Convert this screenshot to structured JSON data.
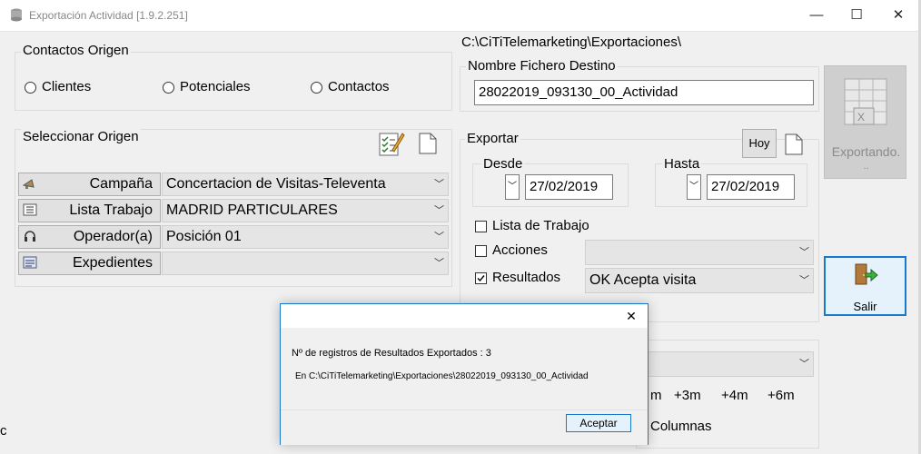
{
  "window": {
    "title": "Exportación Actividad [1.9.2.251]",
    "min_glyph": "—",
    "max_glyph": "☐",
    "close_glyph": "✕"
  },
  "contactos_origen": {
    "label": "Contactos Origen",
    "options": [
      "Clientes",
      "Potenciales",
      "Contactos"
    ]
  },
  "seleccionar_origen": {
    "label": "Seleccionar Origen",
    "rows": [
      {
        "button": "Campaña",
        "value": "Concertacion de Visitas-Televenta"
      },
      {
        "button": "Lista Trabajo",
        "value": "MADRID PARTICULARES"
      },
      {
        "button": "Operador(a)",
        "value": "Posición 01"
      },
      {
        "button": "Expedientes",
        "value": ""
      }
    ]
  },
  "destino": {
    "path": "C:\\CiTiTelemarketing\\Exportaciones\\",
    "label": "Nombre Fichero Destino",
    "filename": "28022019_093130_00_Actividad"
  },
  "exportar": {
    "label": "Exportar",
    "hoy_label": "Hoy",
    "desde_label": "Desde",
    "desde_value": "27/02/2019",
    "hasta_label": "Hasta",
    "hasta_value": "27/02/2019",
    "lista_label": "Lista de Trabajo",
    "acciones_label": "Acciones",
    "acciones_value": "",
    "resultados_label": "Resultados",
    "resultados_value": "OK Acepta visita"
  },
  "side_buttons": {
    "exportando_label": "Exportando.",
    "exportando_dots": "..",
    "salir_label": "Salir"
  },
  "bottom": {
    "offsets": [
      "m",
      "+3m",
      "+4m",
      "+6m"
    ],
    "columnas_label": "Columnas",
    "left_char": "c"
  },
  "dialog": {
    "close_glyph": "✕",
    "line1": "Nº de registros de Resultados Exportados : 3",
    "line2": "En C:\\CiTiTelemarketing\\Exportaciones\\28022019_093130_00_Actividad",
    "ok_label": "Aceptar"
  },
  "colors": {
    "accent": "#1979ca",
    "check": "#2a7a2a"
  }
}
